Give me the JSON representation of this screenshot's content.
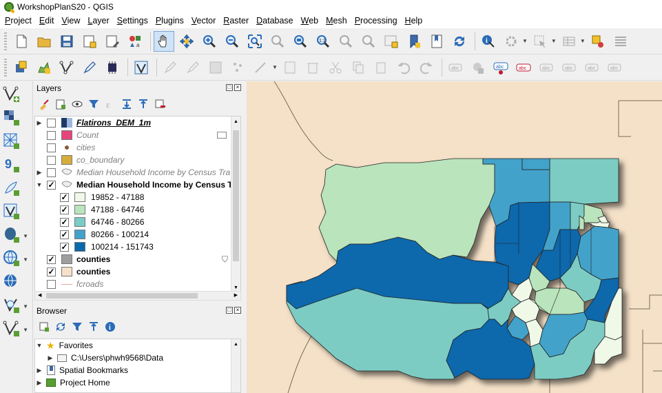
{
  "window": {
    "title": "WorkshopPlanS20 - QGIS"
  },
  "menu": [
    "Project",
    "Edit",
    "View",
    "Layer",
    "Settings",
    "Plugins",
    "Vector",
    "Raster",
    "Database",
    "Web",
    "Mesh",
    "Processing",
    "Help"
  ],
  "layers_panel": {
    "title": "Layers",
    "layers": [
      {
        "name": "Flatirons_DEM_1m",
        "checked": false,
        "style": "raster"
      },
      {
        "name": "Count",
        "checked": false,
        "style": "muted",
        "swatch": "#e6457a"
      },
      {
        "name": "cities",
        "checked": false,
        "style": "muted"
      },
      {
        "name": "co_boundary",
        "checked": false,
        "style": "muted",
        "swatch": "#d6ac3b"
      },
      {
        "name": "Median Household Income by Census Tra",
        "checked": false,
        "style": "muted"
      },
      {
        "name": "Median Household Income by Census Tra",
        "checked": true,
        "style": "bold"
      },
      {
        "name": "counties",
        "checked": true,
        "style": "bold",
        "swatch": "#9e9e9e"
      },
      {
        "name": "counties",
        "checked": true,
        "style": "bold",
        "swatch": "#f5e1c8"
      },
      {
        "name": "fcroads",
        "checked": false,
        "style": "muted"
      }
    ],
    "legend": [
      {
        "label": "19852 - 47188",
        "color": "#f0f9e8"
      },
      {
        "label": "47188 - 64746",
        "color": "#bae4bc"
      },
      {
        "label": "64746 - 80266",
        "color": "#7bccc4"
      },
      {
        "label": "80266 - 100214",
        "color": "#43a2ca"
      },
      {
        "label": "100214 - 151743",
        "color": "#0868ac"
      }
    ]
  },
  "browser_panel": {
    "title": "Browser",
    "items": [
      {
        "label": "Favorites",
        "indent": 0,
        "expanded": true,
        "icon": "star-icon"
      },
      {
        "label": "C:\\Users\\phwh9568\\Data",
        "indent": 1,
        "expanded": false,
        "icon": "folder-icon"
      },
      {
        "label": "Spatial Bookmarks",
        "indent": 0,
        "expanded": false,
        "icon": "bookmark-icon"
      },
      {
        "label": "Project Home",
        "indent": 0,
        "expanded": false,
        "icon": "project-home-icon"
      }
    ]
  },
  "colors": {
    "map_background": "#f5e1c8",
    "accent": "#0868ac"
  }
}
